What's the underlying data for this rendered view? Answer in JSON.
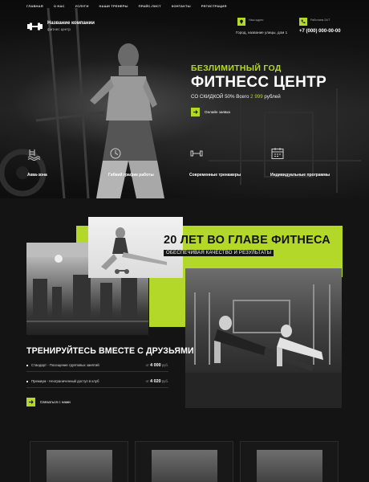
{
  "nav": [
    "ГЛАВНАЯ",
    "О НАС",
    "УСЛУГИ",
    "НАШИ ТРЕНЕРЫ",
    "ПРАЙС-ЛИСТ",
    "КОНТАКТЫ",
    "РЕГИСТРАЦИЯ"
  ],
  "brand": {
    "name": "Название компании",
    "tagline": "фитнес центр"
  },
  "header": {
    "location_label": "Наш адрес",
    "address": "Город, название улицы, дом 1",
    "hours_label": "Работаем 24/7",
    "phone": "+7 (000) 000-00-00"
  },
  "hero": {
    "tag": "БЕЗЛИМИТНЫЙ ГОД",
    "title": "ФИТНЕСС ЦЕНТР",
    "desc_prefix": "СО СКИДКОЙ 50% Всего",
    "desc_price": "2 999",
    "desc_suffix": "рублей",
    "cta": "Онлайн заявка"
  },
  "features": [
    {
      "icon": "pool-icon",
      "label": "Аква-зона"
    },
    {
      "icon": "clock-icon",
      "label": "Гибкий график работы"
    },
    {
      "icon": "dumbbell-icon",
      "label": "Современные тренажеры"
    },
    {
      "icon": "calendar-icon",
      "label": "Индивидуальные программы"
    }
  ],
  "about": {
    "title": "20 ЛЕТ ВО ГЛАВЕ ФИТНЕСА",
    "subtitle": "ОБЕСПЕЧИВАЯ КАЧЕСТВО И РЕЗУЛЬТАТЫ"
  },
  "training": {
    "title": "ТРЕНИРУЙТЕСЬ ВМЕСТЕ С ДРУЗЬЯМИ",
    "prices": [
      {
        "name": "Стандарт - Посещение групповых занятий",
        "prefix": "от",
        "value": "4 000",
        "unit": "руб."
      },
      {
        "name": "Премиум - Неограниченный доступ в клуб",
        "prefix": "от",
        "value": "4 020",
        "unit": "руб."
      }
    ],
    "cta": "Связаться с нами"
  },
  "colors": {
    "accent": "#b4d829",
    "background": "#141414"
  }
}
